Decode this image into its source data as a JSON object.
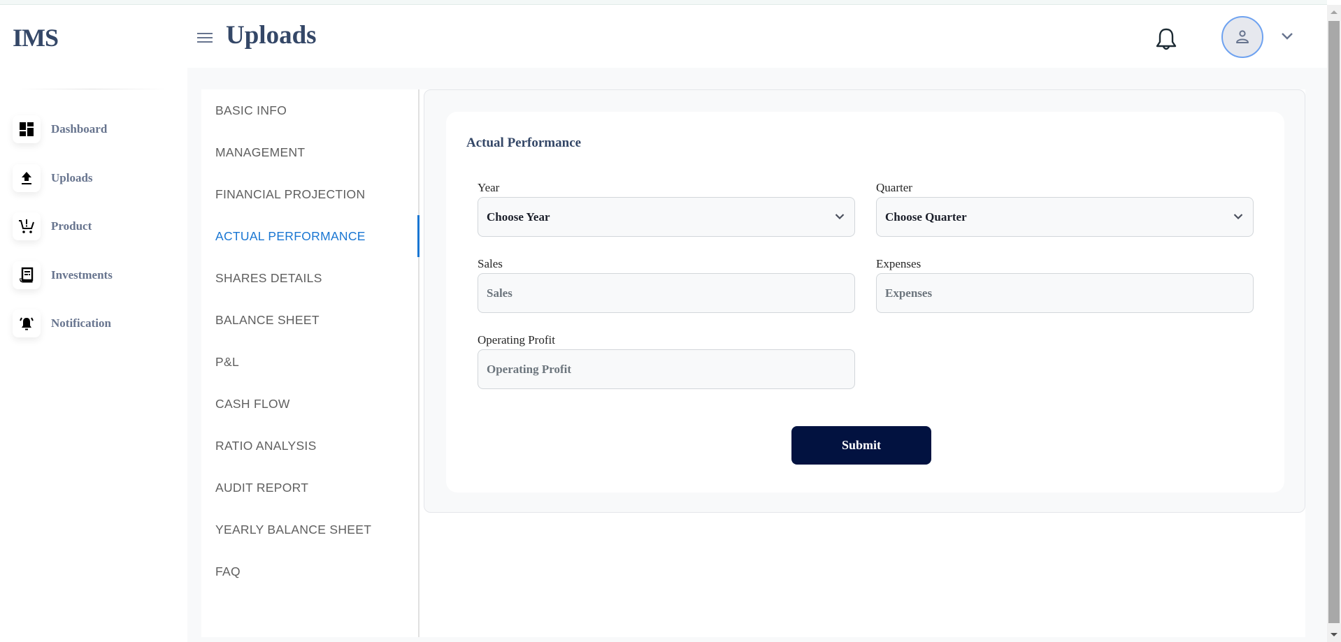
{
  "app": {
    "logo": "IMS"
  },
  "sidebar": {
    "items": [
      {
        "label": "Dashboard",
        "icon": "dashboard-icon"
      },
      {
        "label": "Uploads",
        "icon": "upload-icon"
      },
      {
        "label": "Product",
        "icon": "cart-icon"
      },
      {
        "label": "Investments",
        "icon": "receipt-icon"
      },
      {
        "label": "Notification",
        "icon": "bell-ring-icon"
      }
    ]
  },
  "header": {
    "title": "Uploads",
    "menu_icon": "hamburger-menu-icon",
    "notification_icon": "bell-icon",
    "avatar_icon": "user-icon",
    "avatar_menu_icon": "chevron-down-icon"
  },
  "tabs": {
    "active": "ACTUAL PERFORMANCE",
    "items": [
      "BASIC INFO",
      "MANAGEMENT",
      "FINANCIAL PROJECTION",
      "ACTUAL PERFORMANCE",
      "SHARES DETAILS",
      "BALANCE SHEET",
      "P&L",
      "CASH FLOW",
      "RATIO ANALYSIS",
      "AUDIT REPORT",
      "YEARLY BALANCE SHEET",
      "FAQ"
    ]
  },
  "form": {
    "title": "Actual Performance",
    "year": {
      "label": "Year",
      "value": "Choose Year"
    },
    "quarter": {
      "label": "Quarter",
      "value": "Choose Quarter"
    },
    "sales": {
      "label": "Sales",
      "placeholder": "Sales",
      "value": ""
    },
    "expenses": {
      "label": "Expenses",
      "placeholder": "Expenses",
      "value": ""
    },
    "operating_profit": {
      "label": "Operating Profit",
      "placeholder": "Operating Profit",
      "value": ""
    },
    "submit_label": "Submit"
  },
  "colors": {
    "brand_text": "#344767",
    "active_tab": "#1976d2",
    "submit_bg": "#021240",
    "avatar_ring": "#6ea2f0"
  }
}
